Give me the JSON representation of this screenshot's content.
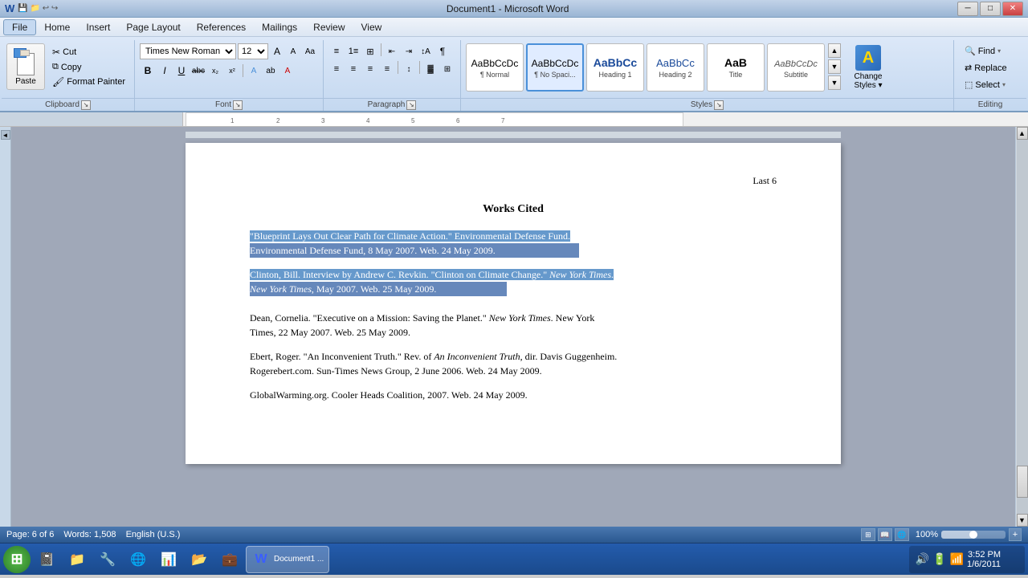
{
  "titlebar": {
    "title": "Document1 - Microsoft Word",
    "minimize": "─",
    "maximize": "□",
    "close": "✕"
  },
  "menubar": {
    "items": [
      "File",
      "Home",
      "Insert",
      "Page Layout",
      "References",
      "Mailings",
      "Review",
      "View"
    ]
  },
  "ribbon": {
    "clipboard": {
      "label": "Clipboard",
      "paste": "Paste",
      "cut": "Cut",
      "copy": "Copy",
      "format_painter": "Format Painter"
    },
    "font": {
      "label": "Font",
      "font_name": "Times New Roman",
      "font_size": "12",
      "bold": "B",
      "italic": "I",
      "underline": "U",
      "strikethrough": "abc",
      "subscript": "x₂",
      "superscript": "x²"
    },
    "paragraph": {
      "label": "Paragraph"
    },
    "styles": {
      "label": "Styles",
      "items": [
        {
          "id": "normal",
          "label": "¶ Normal",
          "sublabel": "Normal"
        },
        {
          "id": "no-spacing",
          "label": "¶ No Spaci...",
          "sublabel": "¶ No Spaci..."
        },
        {
          "id": "heading1",
          "label": "Heading 1",
          "sublabel": "Heading 1"
        },
        {
          "id": "heading2",
          "label": "Heading 2",
          "sublabel": "Heading 2"
        },
        {
          "id": "title",
          "label": "Title",
          "sublabel": "Title"
        },
        {
          "id": "subtitle",
          "label": "Subtitle",
          "sublabel": "Subtitle"
        }
      ],
      "change_styles": "Change Styles ~"
    },
    "editing": {
      "label": "Editing",
      "find": "Find",
      "replace": "Replace",
      "select": "Select"
    }
  },
  "document": {
    "page_number_label": "Last 6",
    "title": "Works Cited",
    "citations": [
      {
        "id": 1,
        "text": "\"Blueprint Lays Out Clear Path for Climate Action.\" Environmental Defense Fund. Environmental Defense Fund, 8 May 2007. Web. 24 May 2009.",
        "selected": true
      },
      {
        "id": 2,
        "text": "Clinton, Bill. Interview by Andrew C. Revkin. \"Clinton on Climate Change.\" New York Times. New York Times, May 2007. Web. 25 May 2009.",
        "selected": true
      },
      {
        "id": 3,
        "text": "Dean, Cornelia. \"Executive on a Mission: Saving the Planet.\" New York Times. New York Times, 22 May 2007. Web. 25 May 2009.",
        "selected": false
      },
      {
        "id": 4,
        "text": "Ebert, Roger. \"An Inconvenient Truth.\" Rev. of An Inconvenient Truth, dir. Davis Guggenheim. Rogerebert.com. Sun-Times News Group, 2 June 2006. Web. 24 May 2009.",
        "selected": false
      },
      {
        "id": 5,
        "text": "GlobalWarming.org. Cooler Heads Coalition, 2007. Web. 24 May 2009.",
        "selected": false
      }
    ]
  },
  "statusbar": {
    "page": "Page: 6 of 6",
    "words": "Words: 1,508",
    "language": "English (U.S.)"
  },
  "taskbar": {
    "time": "3:52 PM",
    "date": "1/6/2011",
    "active_app": "Document1 - Microsoft Word"
  }
}
